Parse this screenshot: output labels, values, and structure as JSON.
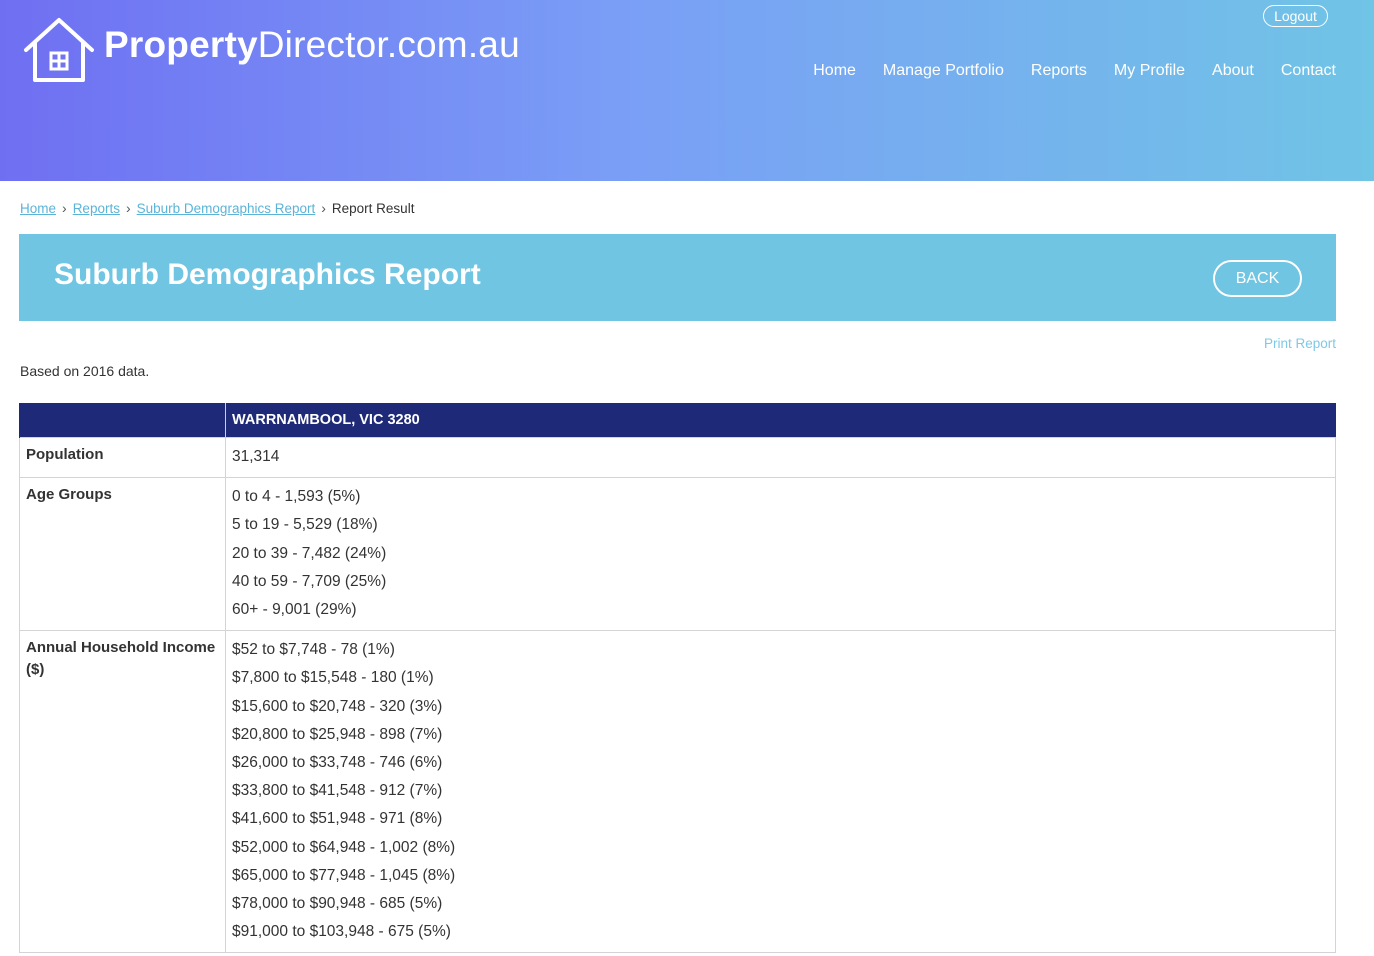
{
  "site": {
    "logo_bold": "Property",
    "logo_light": "Director.com.au",
    "logout_label": "Logout"
  },
  "nav": {
    "items": [
      "Home",
      "Manage Portfolio",
      "Reports",
      "My Profile",
      "About",
      "Contact"
    ]
  },
  "breadcrumb": {
    "home": "Home",
    "reports": "Reports",
    "suburb_report": "Suburb Demographics Report",
    "current": "Report Result"
  },
  "banner": {
    "title": "Suburb Demographics Report",
    "back_label": "BACK"
  },
  "print_label": "Print Report",
  "based_on": "Based on 2016 data.",
  "table": {
    "suburb_header": "WARRNAMBOOL, VIC 3280",
    "population_label": "Population",
    "population_value": "31,314",
    "age_label": "Age Groups",
    "age_groups": [
      "0 to 4 - 1,593 (5%)",
      "5 to 19 - 5,529 (18%)",
      "20 to 39 - 7,482 (24%)",
      "40 to 59 - 7,709 (25%)",
      "60+ - 9,001 (29%)"
    ],
    "income_label": "Annual Household Income ($)",
    "income": [
      "$52 to $7,748 - 78 (1%)",
      "$7,800 to $15,548 - 180 (1%)",
      "$15,600 to $20,748 - 320 (3%)",
      "$20,800 to $25,948 - 898 (7%)",
      "$26,000 to $33,748 - 746 (6%)",
      "$33,800 to $41,548 - 912 (7%)",
      "$41,600 to $51,948 - 971 (8%)",
      "$52,000 to $64,948 - 1,002 (8%)",
      "$65,000 to $77,948 - 1,045 (8%)",
      "$78,000 to $90,948 - 685 (5%)",
      "$91,000 to $103,948 - 675 (5%)"
    ]
  }
}
